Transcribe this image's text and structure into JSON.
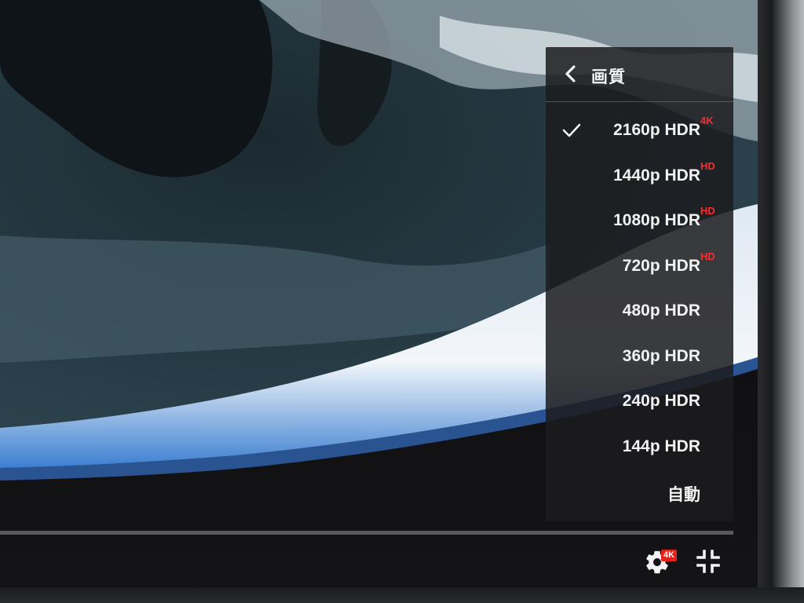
{
  "menu": {
    "title": "画質",
    "items": [
      {
        "label": "2160p HDR",
        "badge": "4K",
        "selected": true
      },
      {
        "label": "1440p HDR",
        "badge": "HD",
        "selected": false
      },
      {
        "label": "1080p HDR",
        "badge": "HD",
        "selected": false
      },
      {
        "label": "720p HDR",
        "badge": "HD",
        "selected": false
      },
      {
        "label": "480p HDR",
        "badge": "",
        "selected": false
      },
      {
        "label": "360p HDR",
        "badge": "",
        "selected": false
      },
      {
        "label": "240p HDR",
        "badge": "",
        "selected": false
      },
      {
        "label": "144p HDR",
        "badge": "",
        "selected": false
      },
      {
        "label": "自動",
        "badge": "",
        "selected": false
      }
    ]
  },
  "controls": {
    "settings_badge": "4K",
    "settings_icon": "gear-icon",
    "exit_fullscreen_icon": "exit-fullscreen-icon"
  },
  "colors": {
    "badge_red": "#ff2b2b",
    "settings_badge_bg": "#e62117"
  }
}
